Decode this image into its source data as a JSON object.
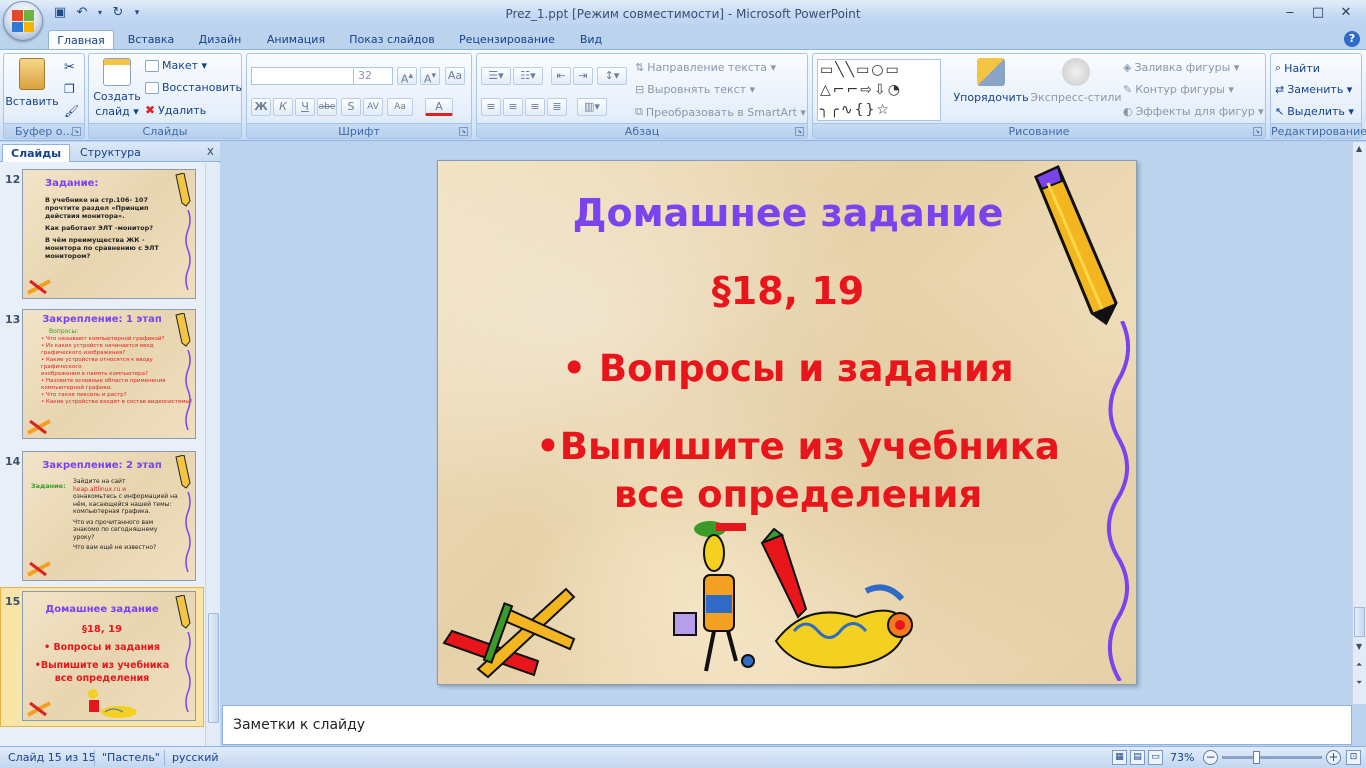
{
  "window": {
    "title": "Prez_1.ppt [Режим совместимости] - Microsoft PowerPoint",
    "controls": [
      "‒",
      "□",
      "✕"
    ]
  },
  "qat": {
    "save_icon": "save-icon",
    "undo_icon": "undo-icon",
    "redo_icon": "redo-icon"
  },
  "ribbon_tabs": [
    "Главная",
    "Вставка",
    "Дизайн",
    "Анимация",
    "Показ слайдов",
    "Рецензирование",
    "Вид"
  ],
  "ribbon": {
    "clipboard": {
      "label": "Буфер о...",
      "paste": "Вставить"
    },
    "slides": {
      "label": "Слайды",
      "create": "Создать",
      "create2": "слайд ▾",
      "layout": "Макет ▾",
      "reset": "Восстановить",
      "delete": "Удалить"
    },
    "font": {
      "label": "Шрифт",
      "font_name": "",
      "font_size": "32",
      "bold": "Ж",
      "italic": "К",
      "underline": "Ч",
      "strike": "abe",
      "shadow": "S",
      "spacing": "AV",
      "case": "Aa",
      "color": "A"
    },
    "paragraph": {
      "label": "Абзац",
      "text_dir": "Направление текста ▾",
      "align_text": "Выровнять текст ▾",
      "smartart": "Преобразовать в SmartArt ▾"
    },
    "drawing": {
      "label": "Рисование",
      "arrange": "Упорядочить",
      "quick_styles": "Экспресс-стили",
      "fill": "Заливка фигуры ▾",
      "outline": "Контур фигуры ▾",
      "effects": "Эффекты для фигур ▾"
    },
    "editing": {
      "label": "Редактирование",
      "find": "Найти",
      "replace": "Заменить ▾",
      "select": "Выделить ▾"
    }
  },
  "left_pane": {
    "tab_slides": "Слайды",
    "tab_outline": "Структура",
    "close": "x"
  },
  "thumbnails": [
    {
      "num": "12",
      "title": "Задание:",
      "lines": [
        "В учебнике на стр.106- 107",
        "прочтите раздел «Принцип",
        "действия монитора».",
        "Как работает ЭЛТ -монитор?",
        "В чём преимущества ЖК -",
        "монитора по сравнению с ЭЛТ",
        "монитором?"
      ]
    },
    {
      "num": "13",
      "title": "Закрепление: 1 этап",
      "sub": "Вопросы:",
      "lines": [
        "• Что называют компьютерной графикой?",
        "• Из каких устройств начинается ввод",
        "  графического изображения?",
        "• Какие устройства относятся к вводу графического",
        "  изображения в память компьютера?",
        "• Назовите основные области применения",
        "  компьютерной графики.",
        "• Что такое пиксель и растр?",
        "• Какие устройства входят в состав видеосистемы?"
      ]
    },
    {
      "num": "14",
      "title": "Закрепление: 2 этап",
      "side": "Задание:",
      "lines": [
        "Зайдите на сайт",
        "heap.altlinux.ru и",
        "ознакомьтесь с информацией на",
        "нём, касающейся нашей темы:",
        "компьютерная графика.",
        "Что из прочитанного вам",
        "знакомо по сегодняшнему",
        "уроку?",
        "Что вам ещё не известно?"
      ]
    },
    {
      "num": "15",
      "title": "Домашнее задание",
      "l1": "§18, 19",
      "l2": "• Вопросы и задания",
      "l3": "•Выпишите из учебника",
      "l4": "все определения"
    }
  ],
  "slide": {
    "title": "Домашнее задание",
    "line1": "§18, 19",
    "line2": "• Вопросы и задания",
    "line3": "•Выпишите из учебника",
    "line4": "все определения"
  },
  "notes": {
    "placeholder": "Заметки к слайду"
  },
  "status": {
    "slide": "Слайд 15 из 15",
    "theme": "\"Пастель\"",
    "lang": "русский",
    "zoom": "73%",
    "zoom_fraction": 0.73
  },
  "colors": {
    "accent": "#15428b",
    "slide_title": "#7b43ee",
    "slide_text": "#e8151b"
  }
}
